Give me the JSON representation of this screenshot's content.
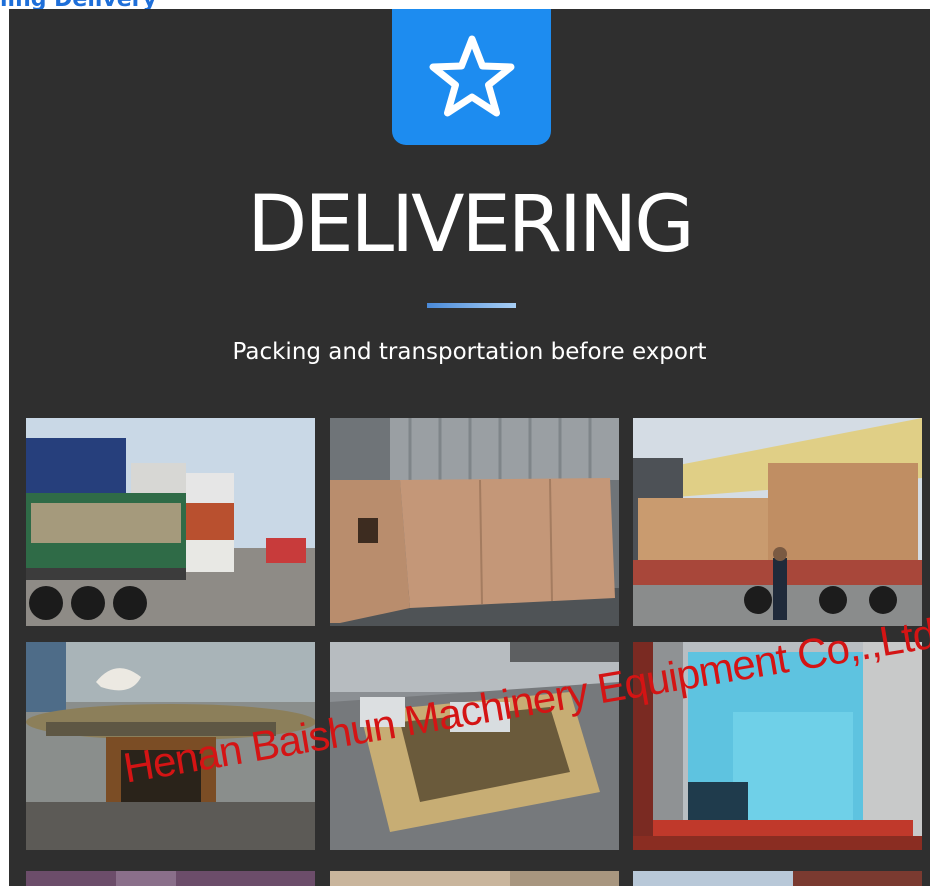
{
  "header": {
    "cut_title": "ling Delivery"
  },
  "hero": {
    "icon": "star-icon",
    "accent_color": "#1d8cf0",
    "title": "DELIVERING",
    "subtitle": "Packing and transportation before export"
  },
  "gallery": {
    "photos": [
      "truck-loaded-with-containers",
      "wooden-crate-in-warehouse",
      "crates-on-flatbed-trailer",
      "welding-positioner-machine",
      "machine-track-assembly",
      "machine-wrapped-in-container"
    ],
    "watermark": "Henan Baishun Machinery Equipment Co,.,Ltd."
  }
}
